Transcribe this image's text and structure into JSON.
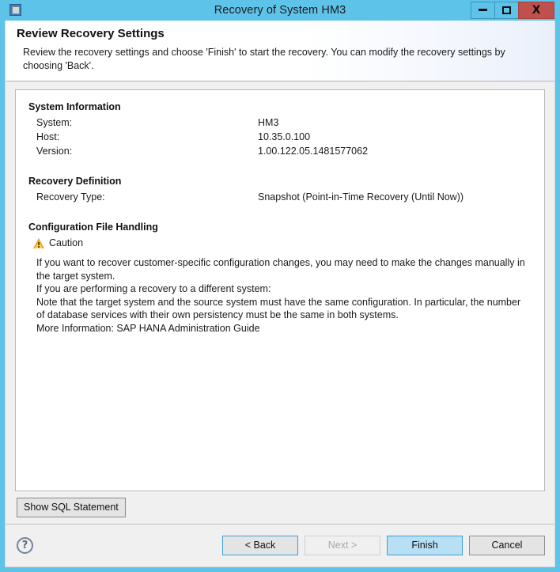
{
  "window": {
    "title": "Recovery of System HM3",
    "icon": "database-window-icon",
    "controls": {
      "minimize": "minimize-icon",
      "maximize": "maximize-icon",
      "close": "X"
    },
    "frame_color": "#5ec3e8",
    "close_color": "#c0504d"
  },
  "header": {
    "title": "Review Recovery Settings",
    "description": "Review the recovery settings and choose 'Finish' to start the recovery. You can modify the recovery settings by choosing 'Back'."
  },
  "sections": {
    "system_information": {
      "title": "System Information",
      "rows": [
        {
          "label": "System:",
          "value": "HM3"
        },
        {
          "label": "Host:",
          "value": "10.35.0.100"
        },
        {
          "label": "Version:",
          "value": "1.00.122.05.1481577062"
        }
      ]
    },
    "recovery_definition": {
      "title": "Recovery Definition",
      "rows": [
        {
          "label": "Recovery Type:",
          "value": "Snapshot (Point-in-Time Recovery (Until Now))"
        }
      ]
    },
    "configuration_file_handling": {
      "title": "Configuration File Handling",
      "caution_label": "Caution",
      "caution_icon": "warning-triangle-icon",
      "caution_color": "#e8a317",
      "lines": [
        "If you want to recover customer-specific configuration changes, you may need to make the changes manually in the target system.",
        "If you are performing a recovery to a different system:",
        "Note that the target system and the source system must have the same configuration. In particular, the number of database services with their own persistency must be the same in both systems.",
        "More Information: SAP HANA Administration Guide"
      ]
    }
  },
  "actions": {
    "show_sql": "Show SQL Statement",
    "help_icon": "?",
    "back": "< Back",
    "next": "Next >",
    "finish": "Finish",
    "cancel": "Cancel"
  }
}
